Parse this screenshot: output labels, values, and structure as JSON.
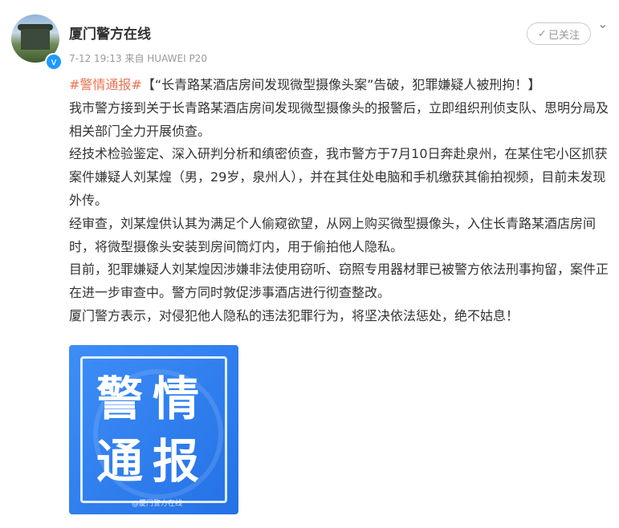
{
  "post": {
    "username": "厦门警方在线",
    "timestamp": "7-12 19:13",
    "source": "来自 HUAWEI P20",
    "follow_label": "已关注",
    "topic": "#警情通报#",
    "headline": "【“长青路某酒店房间发现微型摄像头案”告破，犯罪嫌疑人被刑拘！】",
    "paragraphs": [
      "我市警方接到关于长青路某酒店房间发现微型摄像头的报警后，立即组织刑侦支队、思明分局及相关部门全力开展侦查。",
      "经技术检验鉴定、深入研判分析和缜密侦查，我市警方于7月10日奔赴泉州，在某住宅小区抓获案件嫌疑人刘某煌（男，29岁，泉州人），并在其住处电脑和手机缴获其偷拍视频，目前未发现外传。",
      "经审查，刘某煌供认其为满足个人偷窥欲望，从网上购买微型摄像头，入住长青路某酒店房间时，将微型摄像头安装到房间筒灯内，用于偷拍他人隐私。",
      "目前，犯罪嫌疑人刘某煌因涉嫌非法使用窃听、窃照专用器材罪已被警方依法刑事拘留，案件正在进一步审查中。警方同时敦促涉事酒店进行彻查整改。",
      "厦门警方表示，对侵犯他人隐私的违法犯罪行为，将坚决依法惩处，绝不姑息！"
    ],
    "image": {
      "glyphs": [
        "警",
        "情",
        "通",
        "报"
      ],
      "watermark": "@厦门警方在线"
    }
  },
  "icons": {
    "check": "✓",
    "chevron": "⌄",
    "verified": "v"
  },
  "colors": {
    "topic": "#eb7350",
    "verified": "#1e9bff",
    "image_bg": "#2f80f0"
  }
}
